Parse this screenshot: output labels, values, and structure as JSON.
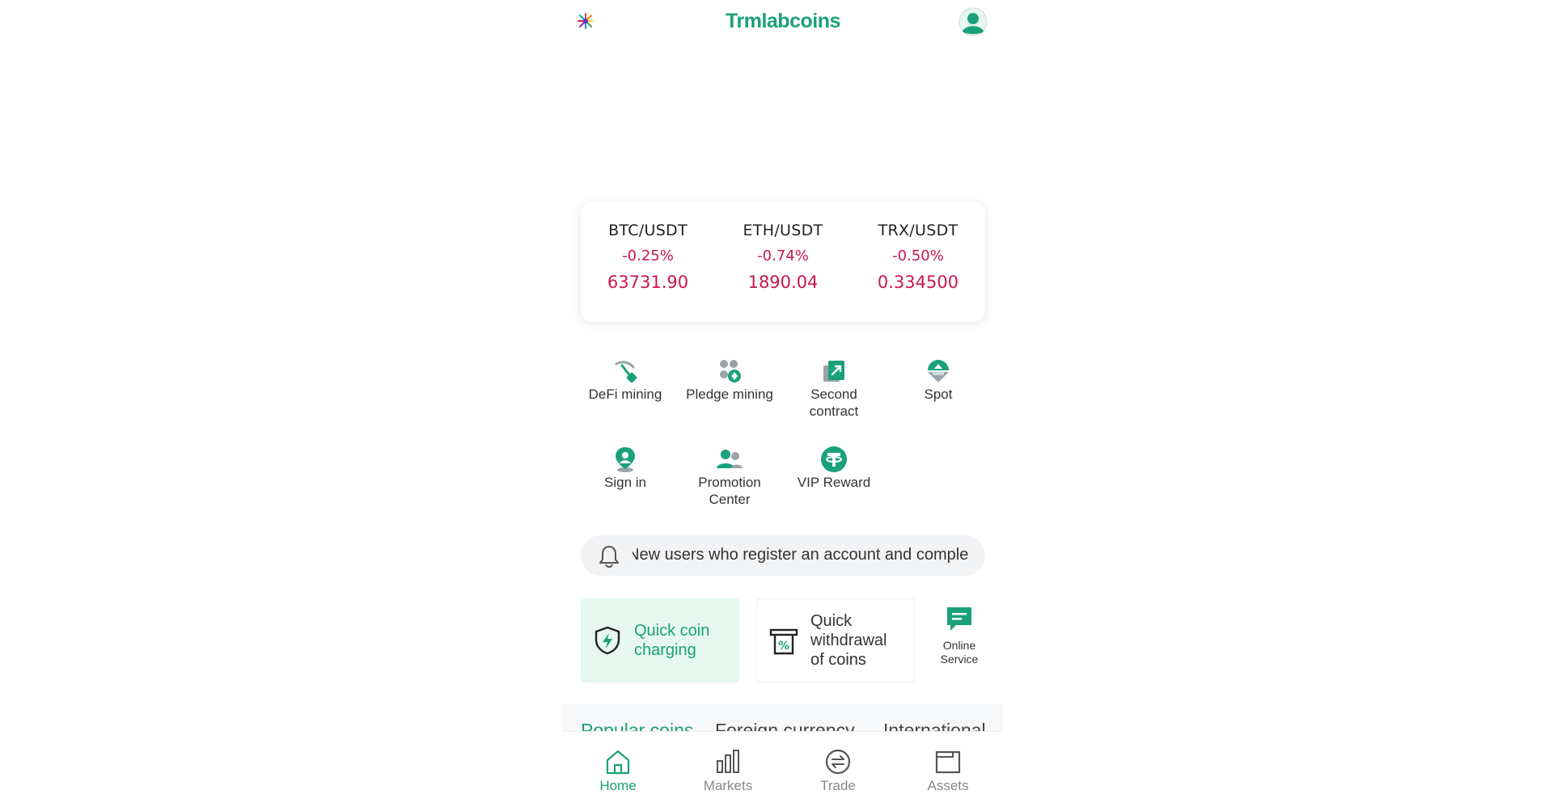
{
  "header": {
    "brand": "Trmlabcoins",
    "logo_icon": "spark-logo-icon",
    "avatar_icon": "user-avatar-icon"
  },
  "ticker": [
    {
      "pair": "BTC/USDT",
      "change": "-0.25%",
      "price": "63731.90"
    },
    {
      "pair": "ETH/USDT",
      "change": "-0.74%",
      "price": "1890.04"
    },
    {
      "pair": "TRX/USDT",
      "change": "-0.50%",
      "price": "0.334500"
    }
  ],
  "features": [
    {
      "label": "DeFi mining",
      "icon": "pickaxe-icon"
    },
    {
      "label": "Pledge mining",
      "icon": "coins-icon"
    },
    {
      "label": "Second contract",
      "icon": "contract-icon"
    },
    {
      "label": "Spot",
      "icon": "spot-icon"
    },
    {
      "label": "Sign in",
      "icon": "location-pin-icon"
    },
    {
      "label": "Promotion Center",
      "icon": "users-icon"
    },
    {
      "label": "VIP Reward",
      "icon": "tether-icon"
    }
  ],
  "notice": {
    "icon": "bell-icon",
    "text": "New users who register an account and comple"
  },
  "quick_actions": {
    "charge": "Quick coin charging",
    "withdraw": "Quick withdrawal of coins",
    "online_service": "Online Service"
  },
  "market_tabs": [
    "Popular coins",
    "Foreign currency",
    "International"
  ],
  "bottom_nav": [
    {
      "label": "Home",
      "icon": "home-icon"
    },
    {
      "label": "Markets",
      "icon": "bar-chart-icon"
    },
    {
      "label": "Trade",
      "icon": "exchange-icon"
    },
    {
      "label": "Assets",
      "icon": "wallet-icon"
    }
  ],
  "colors": {
    "brand_green": "#1aa179",
    "down_red": "#c8184a",
    "charge_bg": "#e6f8f0"
  }
}
